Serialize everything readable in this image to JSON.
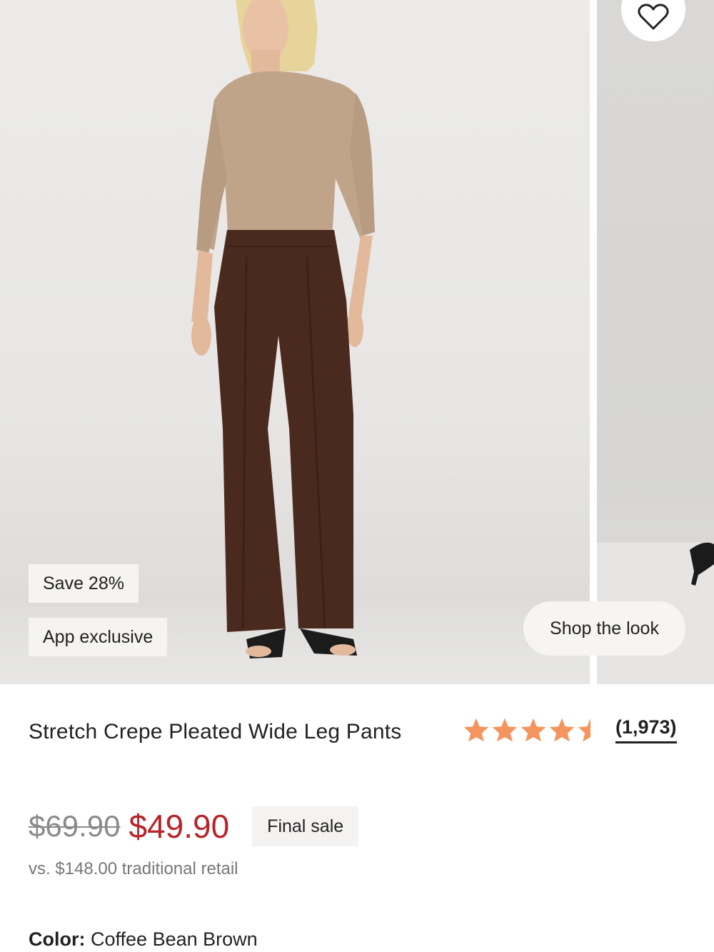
{
  "badges": {
    "save": "Save 28%",
    "app_exclusive": "App exclusive"
  },
  "shop_the_look": "Shop the look",
  "product": {
    "title": "Stretch Crepe Pleated Wide Leg Pants",
    "rating_value": 4.5,
    "rating_count": "(1,973)",
    "original_price": "$69.90",
    "sale_price": "$49.90",
    "final_sale": "Final sale",
    "retail_comparison": "vs. $148.00 traditional retail",
    "color_label": "Color:",
    "color_value": "Coffee Bean Brown"
  },
  "icons": {
    "favorite": "heart-icon",
    "star": "star-icon"
  },
  "colors": {
    "sale_price": "#b5252a",
    "star": "#f4955f",
    "text": "#222222"
  }
}
